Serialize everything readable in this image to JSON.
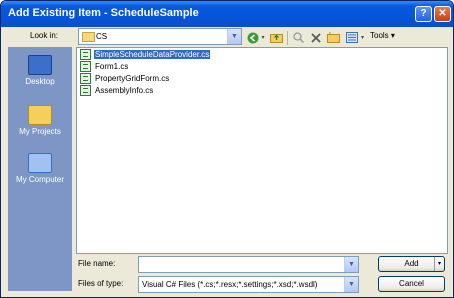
{
  "window": {
    "title": "Add Existing Item - ScheduleSample",
    "help": "?",
    "close": "✕"
  },
  "toolbar": {
    "look_in_label": "Look in:",
    "look_in_value": "CS",
    "tools_label": "Tools ▾"
  },
  "places": [
    {
      "label": "Desktop",
      "icon": "desktop-icon"
    },
    {
      "label": "My Projects",
      "icon": "folder-icon"
    },
    {
      "label": "My Computer",
      "icon": "computer-icon"
    }
  ],
  "files": [
    {
      "name": "SimpleScheduleDataProvider.cs",
      "selected": true
    },
    {
      "name": "Form1.cs",
      "selected": false
    },
    {
      "name": "PropertyGridForm.cs",
      "selected": false
    },
    {
      "name": "AssemblyInfo.cs",
      "selected": false
    }
  ],
  "bottom": {
    "file_name_label": "File name:",
    "file_name_value": "",
    "files_of_type_label": "Files of type:",
    "files_of_type_value": "Visual C# Files (*.cs;*.resx;*.settings;*.xsd;*.wsdl)",
    "add_label": "Add",
    "cancel_label": "Cancel"
  },
  "colors": {
    "title_blue": "#0653D6",
    "places_bar": "#7D96C5",
    "selection": "#316AC5"
  }
}
